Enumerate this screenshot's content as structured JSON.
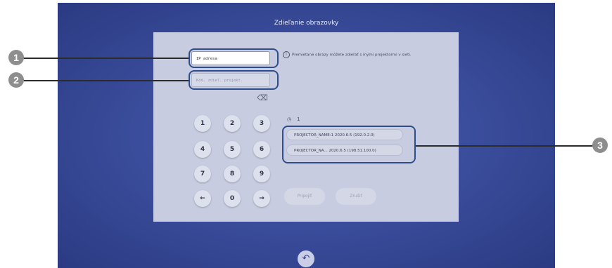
{
  "screen": {
    "title": "Zdieľanie obrazovky",
    "ip_field": {
      "placeholder": "IP adresa"
    },
    "projector_field": {
      "placeholder": "Kód. zdieľ. projekt."
    },
    "info_text": "Premietané obrazy môžete zdieľať s inými projektormi v sieti.",
    "keypad": [
      "1",
      "2",
      "3",
      "4",
      "5",
      "6",
      "7",
      "8",
      "9",
      "←",
      "0",
      "→"
    ],
    "backspace_icon": "⌫",
    "history": {
      "icon": "history-icon",
      "count": "1"
    },
    "projectors": [
      "PROJECTOR_NAME:1  2020.6.5 (192.0.2.0)",
      "PROJECTOR_NA...  2020.6.5 (198.51.100.0)"
    ],
    "connect_label": "Pripojiť",
    "cancel_label": "Zrušiť",
    "back_label": "Späť"
  },
  "callouts": [
    "1",
    "2",
    "3"
  ]
}
